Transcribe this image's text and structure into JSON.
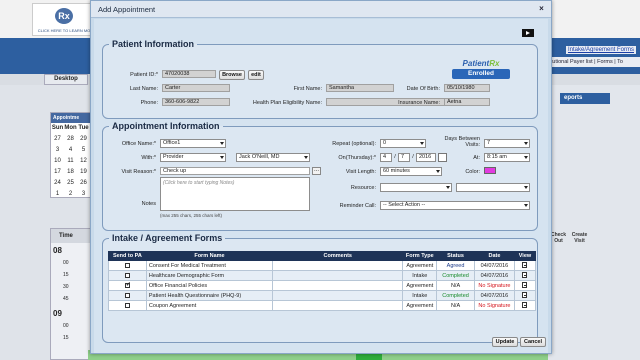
{
  "background": {
    "logo_caption": "CLICK HERE TO LEARN MO",
    "logo_mark": "Rx",
    "top_link": "Intake/Agreement Forms",
    "menu_text": "titutional Payer list | Forms | To",
    "tab_desktop": "Desktop",
    "appointments_label": "Appointme",
    "reports_label": "eports",
    "calendar": {
      "days": [
        "Sun",
        "Mon",
        "Tue"
      ],
      "rows": [
        [
          "27",
          "28",
          "29"
        ],
        [
          "3",
          "4",
          "5"
        ],
        [
          "10",
          "11",
          "12"
        ],
        [
          "17",
          "18",
          "19"
        ],
        [
          "24",
          "25",
          "26"
        ],
        [
          "1",
          "2",
          "3"
        ]
      ]
    },
    "schedule": {
      "time_header": "Time",
      "hours": [
        "08",
        "09"
      ],
      "minutes": [
        "00",
        "15",
        "30",
        "45",
        "00",
        "15"
      ]
    },
    "right_cols": [
      "Check Out",
      "Create Visit"
    ]
  },
  "modal": {
    "title": "Add Appointment",
    "close_glyph": "×",
    "patient": {
      "legend": "Patient Information",
      "patient_id_label": "Patient ID:*",
      "patient_id": "47020038",
      "browse": "Browse",
      "edit": "edit",
      "last_name_label": "Last Name:",
      "last_name": "Carter",
      "first_name_label": "First Name:",
      "first_name": "Samantha",
      "dob_label": "Date Of Birth:",
      "dob": "05/10/1980",
      "phone_label": "Phone:",
      "phone": "360-606-9822",
      "health_plan_label": "Health Plan Eligibility Name:",
      "health_plan": "",
      "insurance_label": "Insurance Name:",
      "insurance": "Aetna",
      "badge_logo_a": "Patient",
      "badge_logo_b": "Rx",
      "badge_status": "Enrolled"
    },
    "appointment": {
      "legend": "Appointment Information",
      "office_label": "Office Name:*",
      "office": "Office1",
      "with_label": "With:*",
      "with_type": "Provider",
      "with_name": "Jack O'Neill, MD",
      "visit_reason_label": "Visit Reason:*",
      "visit_reason": "Check up",
      "notes_label": "Notes",
      "notes_placeholder": "(Click here to start typing Notes)",
      "notes_hint": "(max 255 chars, 255 chars left)",
      "repeat_label": "Repeat (optional):",
      "repeat": "0",
      "days_between_label": "Days Between Visits:",
      "days_between": "7",
      "on_label": "On(Thursday):*",
      "month": "4",
      "day": "7",
      "year": "2016",
      "at_label": "At:",
      "at_time": "8:15 am",
      "visit_length_label": "Visit Length:",
      "visit_length": "60 minutes",
      "color_label": "Color:",
      "color_value": "#e23ce0",
      "resource_label": "Resource:",
      "reminder_label": "Reminder Call:",
      "reminder": "-- Select Action --"
    },
    "forms": {
      "legend": "Intake / Agreement Forms",
      "headers": [
        "Send to PA",
        "Form Name",
        "Comments",
        "Form Type",
        "Status",
        "Date",
        "View"
      ],
      "rows": [
        {
          "name": "Consent For Medical Treatment",
          "comments": "",
          "type": "Agreement",
          "status": "Agreed",
          "status_color": "#1b3a8a",
          "date": "04/07/2016",
          "checked": false
        },
        {
          "name": "Healthcare Demographic Form",
          "comments": "",
          "type": "Intake",
          "status": "Completed",
          "status_color": "#178a2a",
          "date": "04/07/2016",
          "checked": false
        },
        {
          "name": "Office Financial Policies",
          "comments": "",
          "type": "Agreement",
          "status": "N/A",
          "status_color": "#222222",
          "date": "No Signature",
          "checked": true
        },
        {
          "name": "Patient Health Questionnaire (PHQ-9)",
          "comments": "",
          "type": "Intake",
          "status": "Completed",
          "status_color": "#178a2a",
          "date": "04/07/2016",
          "checked": false
        },
        {
          "name": "Coupon Agreement",
          "comments": "",
          "type": "Agreement",
          "status": "N/A",
          "status_color": "#222222",
          "date": "No Signature",
          "checked": false
        }
      ]
    },
    "update_button": "Update",
    "cancel_button": "Cancel"
  }
}
